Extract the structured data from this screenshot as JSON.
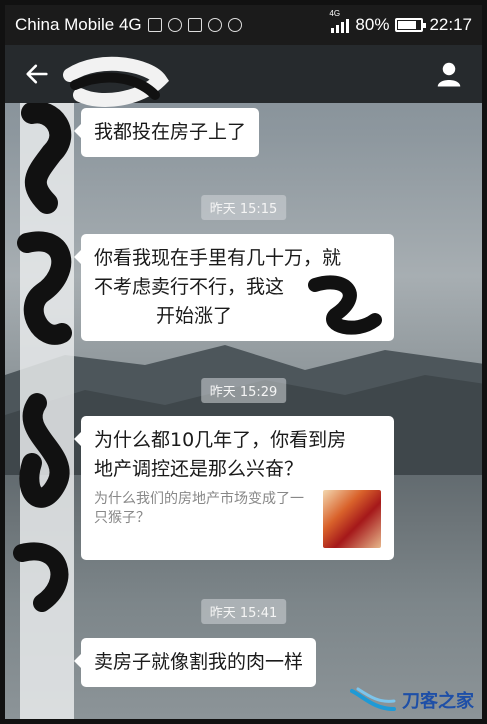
{
  "status_bar": {
    "carrier": "China Mobile 4G",
    "network_label": "4G",
    "battery": "80%",
    "battery_level": 0.8,
    "time": "22:17"
  },
  "nav": {
    "back_icon": "back-arrow-icon",
    "profile_icon": "person-icon"
  },
  "messages": [
    {
      "type": "text",
      "text": "我都投在房子上了"
    },
    {
      "type": "time",
      "text": "昨天 15:15"
    },
    {
      "type": "text",
      "lines": [
        "你看我现在手里有几十万，就",
        "不考虑卖行不行，我这",
        "开始涨了"
      ]
    },
    {
      "type": "time",
      "text": "昨天 15:29"
    },
    {
      "type": "link",
      "lines": [
        "为什么都10几年了，你看到房",
        "地产调控还是那么兴奋？"
      ],
      "preview": "为什么我们的房地产市场变成了一只猴子？"
    },
    {
      "type": "time",
      "text": "昨天 15:41"
    },
    {
      "type": "text",
      "text": "卖房子就像割我的肉一样"
    }
  ],
  "watermark": {
    "text": "刀客之家"
  },
  "colors": {
    "bubble": "#ffffff",
    "navbar": "#262a2d",
    "statusbar": "#1b1b1b",
    "watermark": "#1e4fa7"
  }
}
